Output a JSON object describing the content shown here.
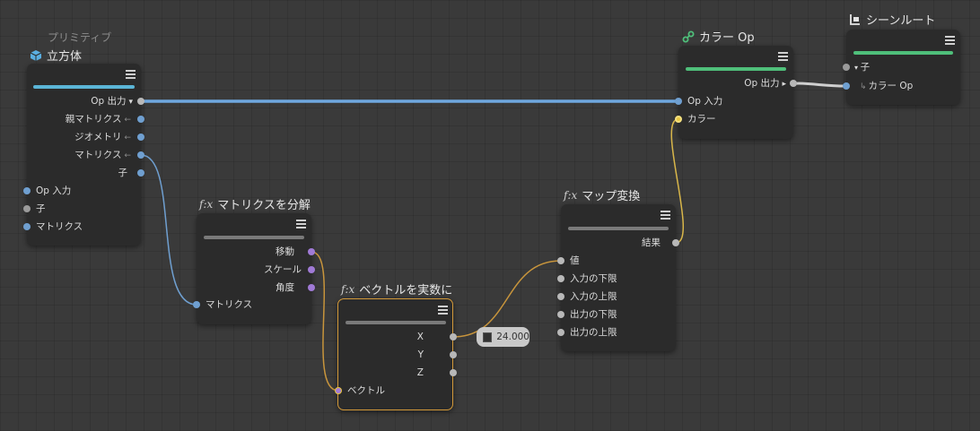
{
  "colors": {
    "background": "#3a3a3a",
    "node_bg": "#2b2b2b",
    "selection": "#d49a3a",
    "wire_blue": "#6fa8e0",
    "wire_orange": "#c8953c",
    "wire_yellow": "#d8b64a",
    "wire_gray": "#cfcfcf",
    "bar_cyan": "#5bb5d6",
    "bar_green": "#4fbf7a",
    "bar_gray": "#7a7a7a",
    "port_blue": "#6f9fd0",
    "port_purple": "#a07ad6",
    "port_gray": "#b8b8b8",
    "port_yellow": "#e8c640"
  },
  "nodes": {
    "cube": {
      "subtitle": "プリミティブ",
      "title": "立方体",
      "icon": "cube-icon",
      "outputs": [
        "Op 出力",
        "親マトリクス",
        "ジオメトリ",
        "マトリクス",
        "子"
      ],
      "inputs": [
        "Op 入力",
        "子",
        "マトリクス"
      ]
    },
    "decompose": {
      "title": "マトリクスを分解",
      "fx": "f:x",
      "outputs": [
        "移動",
        "スケール",
        "角度"
      ],
      "inputs": [
        "マトリクス"
      ]
    },
    "vector_to_real": {
      "title": "ベクトルを実数に",
      "fx": "f:x",
      "outputs": [
        "X",
        "Y",
        "Z"
      ],
      "inputs": [
        "ベクトル"
      ]
    },
    "map": {
      "title": "マップ変換",
      "fx": "f:x",
      "outputs": [
        "結果"
      ],
      "inputs": [
        "値",
        "入力の下限",
        "入力の上限",
        "出力の下限",
        "出力の上限"
      ]
    },
    "color_op": {
      "title": "カラー Op",
      "icon": "color-op-icon",
      "outputs": [
        "Op 出力"
      ],
      "inputs": [
        "Op 入力",
        "カラー"
      ]
    },
    "scene_root": {
      "title": "シーンルート",
      "icon": "scene-root-icon",
      "inputs": [
        "子",
        "カラー Op"
      ]
    }
  },
  "value_preview": "24.000"
}
